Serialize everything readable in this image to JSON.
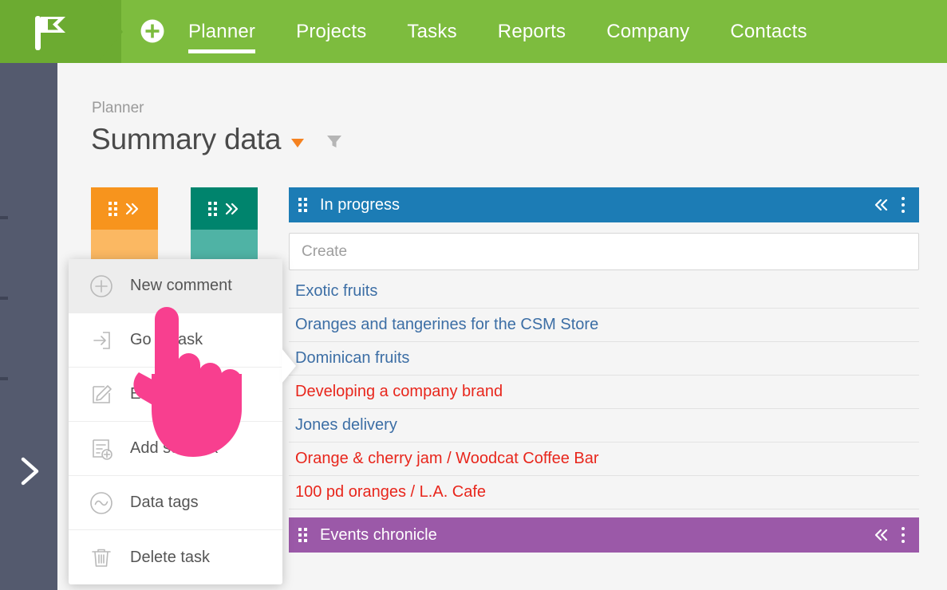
{
  "header": {
    "logo_icon": "flag-icon",
    "add_icon": "plus-circle-icon",
    "nav": [
      {
        "label": "Planner",
        "active": true
      },
      {
        "label": "Projects",
        "active": false
      },
      {
        "label": "Tasks",
        "active": false
      },
      {
        "label": "Reports",
        "active": false
      },
      {
        "label": "Company",
        "active": false
      },
      {
        "label": "Contacts",
        "active": false
      }
    ],
    "brand_green": "#7dbc3e",
    "brand_green_dark": "#6cab31"
  },
  "sidebar": {
    "expand_icon": "chevron-right-icon",
    "background": "#545a6e"
  },
  "page": {
    "breadcrumb": "Planner",
    "title": "Summary data",
    "title_caret_icon": "caret-down-icon",
    "title_caret_color": "#f58220",
    "filter_icon": "filter-funnel-icon"
  },
  "columns": [
    {
      "name": "orange-column-card",
      "head_color": "#f7941d",
      "body_color": "#fbb862",
      "grip_icon": "drag-grip-icon",
      "collapse_icon": "chevron-double-right-icon",
      "body_icon": "corner-arrow-icon"
    },
    {
      "name": "teal-column-card",
      "head_color": "#00846d",
      "body_color": "#4fb3a5",
      "grip_icon": "drag-grip-icon",
      "collapse_icon": "chevron-double-right-icon",
      "body_icon": "chevron-down-icon"
    }
  ],
  "panels": [
    {
      "title": "In progress",
      "color": "#1c7cb5",
      "grip_icon": "drag-grip-icon",
      "collapse_icon": "chevron-double-left-icon",
      "menu_icon": "more-vertical-icon",
      "create": {
        "value": "",
        "placeholder": "Create"
      },
      "tasks": [
        {
          "label": "Exotic fruits",
          "color": "blue"
        },
        {
          "label": "Oranges and tangerines for the CSM Store",
          "color": "blue"
        },
        {
          "label": "Dominican fruits",
          "color": "blue"
        },
        {
          "label": "Developing a company brand",
          "color": "red"
        },
        {
          "label": "Jones delivery",
          "color": "blue"
        },
        {
          "label": "Orange & cherry jam / Woodcat Coffee Bar",
          "color": "red"
        },
        {
          "label": "100 pd oranges / L.A. Cafe",
          "color": "red"
        }
      ]
    },
    {
      "title": "Events chronicle",
      "color": "#9b59a8",
      "grip_icon": "drag-grip-icon",
      "collapse_icon": "chevron-double-left-icon",
      "menu_icon": "more-vertical-icon"
    }
  ],
  "context_menu": {
    "items": [
      {
        "label": "New comment",
        "icon": "plus-circle-outline-icon",
        "highlight": true
      },
      {
        "label": "Go to task",
        "icon": "arrow-into-box-icon",
        "highlight": false
      },
      {
        "label": "Edit task",
        "icon": "pencil-page-icon",
        "highlight": false
      },
      {
        "label": "Add subtask",
        "icon": "document-plus-icon",
        "highlight": false
      },
      {
        "label": "Data tags",
        "icon": "tilde-circle-icon",
        "highlight": false
      },
      {
        "label": "Delete task",
        "icon": "trash-icon",
        "highlight": false
      }
    ]
  },
  "cursor": {
    "icon": "pointing-hand-cursor",
    "color": "#f83f8f"
  },
  "task_colors": {
    "link": "#3c6ea5",
    "alert": "#e8261c"
  }
}
